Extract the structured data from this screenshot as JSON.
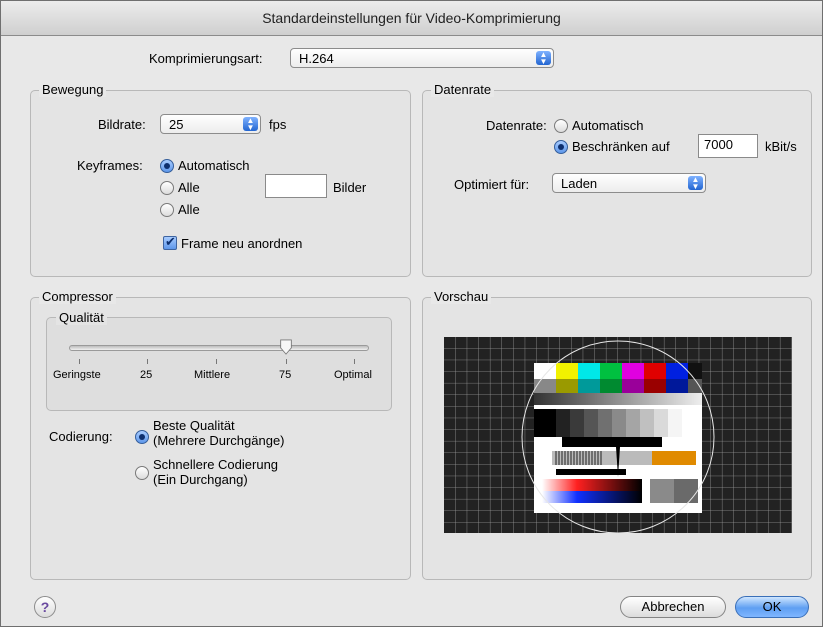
{
  "window": {
    "title": "Standardeinstellungen für Video-Komprimierung"
  },
  "compression": {
    "label": "Komprimierungsart:",
    "value": "H.264"
  },
  "motion": {
    "title": "Bewegung",
    "framerate_label": "Bildrate:",
    "framerate_value": "25",
    "framerate_unit": "fps",
    "keyframes_label": "Keyframes:",
    "keyframe_options": [
      "Automatisch",
      "Alle",
      "Alle"
    ],
    "keyframe_selected_index": 0,
    "keyframe_frames_value": "",
    "keyframe_frames_unit": "Bilder",
    "reorder_label": "Frame neu anordnen",
    "reorder_checked": true
  },
  "datarate": {
    "title": "Datenrate",
    "label": "Datenrate:",
    "option_auto": "Automatisch",
    "option_limit": "Beschränken auf",
    "selected": "limit",
    "value": "7000",
    "unit": "kBit/s",
    "optimized_label": "Optimiert für:",
    "optimized_value": "Laden"
  },
  "compressor": {
    "title": "Compressor",
    "quality_title": "Qualität",
    "quality_labels": [
      "Geringste",
      "25",
      "Mittlere",
      "75",
      "Optimal"
    ],
    "quality_value_percent": 75,
    "coding_label": "Codierung:",
    "coding_options": [
      {
        "line1": "Beste Qualität",
        "line2": "(Mehrere Durchgänge)"
      },
      {
        "line1": "Schnellere Codierung",
        "line2": "(Ein Durchgang)"
      }
    ],
    "coding_selected_index": 0
  },
  "preview": {
    "title": "Vorschau"
  },
  "buttons": {
    "help": "?",
    "cancel": "Abbrechen",
    "ok": "OK"
  },
  "colors": {
    "accent": "#5f9ff2",
    "radio_dot": "#0d2f6e",
    "window_bg": "#e8e8e8"
  }
}
